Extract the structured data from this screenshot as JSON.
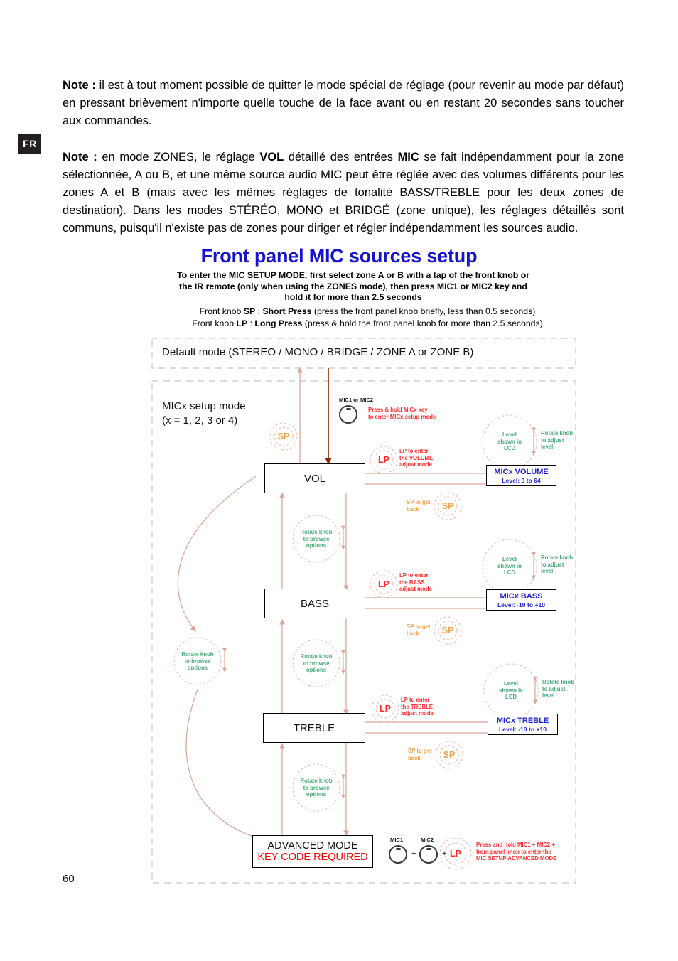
{
  "lang_tag": "FR",
  "page_number": "60",
  "notes": [
    "Note : il est à tout moment possible de quitter le mode spécial de réglage (pour revenir au mode par défaut) en pressant brièvement n'importe quelle touche de la face avant ou en restant 20 secondes sans toucher aux commandes.",
    "Note : en mode ZONES, le réglage VOL détaillé des entrées MIC se fait indépendamment pour la zone sélectionnée, A ou B, et une même source audio MIC peut être réglée avec des volumes différents pour les zones A et B (mais avec les mêmes réglages de tonalité BASS/TREBLE pour les deux zones de destination). Dans les modes STÉRÉO, MONO et BRIDGÉ (zone unique), les réglages détaillés sont communs, puisqu'il n'existe pas de zones pour diriger et régler indépendamment les sources audio."
  ],
  "heading": {
    "title": "Front panel MIC sources setup",
    "title_color": "#1414cf",
    "subtitle_lines": [
      "To enter the MIC SETUP MODE, first select zone A or B with a tap of the front knob or",
      "the IR remote (only when using the  ZONES mode), then press MIC1 or MIC2 key and",
      "hold it for more than 2.5 seconds"
    ]
  },
  "legend": {
    "sp": {
      "prefix": "Front knob  ",
      "code": "SP",
      "sep": " : ",
      "name": "Short Press",
      "desc": "  (press the front panel knob briefly, less than 0.5 seconds)"
    },
    "lp": {
      "prefix": "Front knob  ",
      "code": "LP",
      "sep": " : ",
      "name": "Long Press",
      "desc": "  (press & hold the front panel knob for more than 2.5 seconds)"
    }
  },
  "diagram": {
    "outer_frame_label": "Default mode (STEREO / MONO / BRIDGE / ZONE A or ZONE B)",
    "inner_frame_label": "MICx setup mode\n(x = 1, 2, 3 or 4)",
    "mic_entry": {
      "knob_label": "MIC1 or MIC2",
      "note": "Press & hold MICx key\nto enter MICx setup mode",
      "note_color": "#ff2b2b"
    },
    "top_token": {
      "label": "SP"
    },
    "steps": [
      {
        "name": "VOL",
        "lp_token": "LP",
        "lp_note": "LP to enter\nthe VOLUME\nadjust mode",
        "sp_token": "SP",
        "sp_note": "SP to get\nback",
        "lcd_title": "MICx VOLUME",
        "lcd_sub": "Level: 0 to 64",
        "level_circle": "Level\nshown in\nLCD",
        "rotate_note": "Rotate knob\nto adjust\nlevel"
      },
      {
        "name": "BASS",
        "lp_token": "LP",
        "lp_note": "LP to enter\nthe BASS\nadjust mode",
        "sp_token": "SP",
        "sp_note": "SP to get\nback",
        "lcd_title": "MICx BASS",
        "lcd_sub": "Level: -10 to +10",
        "level_circle": "Level\nshown in\nLCD",
        "rotate_note": "Rotate knob\nto adjust\nlevel"
      },
      {
        "name": "TREBLE",
        "lp_token": "LP",
        "lp_note": "LP to enter\nthe TREBLE\nadjust mode",
        "sp_token": "SP",
        "sp_note": "SP to get\nback",
        "lcd_title": "MICx TREBLE",
        "lcd_sub": "Level: -10 to +10",
        "level_circle": "Level\nshown in\nLCD",
        "rotate_note": "Rotate knob\nto adjust\nlevel"
      }
    ],
    "browse_notes": [
      "Rotate knob\nto browse\noptions",
      "Rotate knob\nto browse\noptions",
      "Rotate knob\nto browse\noptions",
      "Rotate knob\nto browse\noptions"
    ],
    "advanced": {
      "line1": "ADVANCED MODE",
      "line2": "KEY CODE REQUIRED",
      "line2_color": "#ff0000",
      "mic1_label": "MIC1",
      "mic2_label": "MIC2",
      "plus1": "+",
      "plus2": "+",
      "lp_token": "LP",
      "note": "Press and hold MIC1 + MIC2 +\nfront panel knob to enter the\nMIC SETUP ADVANCED MODE"
    }
  },
  "colors": {
    "flow_line": "#d9a79a",
    "mic_line": "#8b2500",
    "green": "#4aab7a",
    "red": "#ff2b2b",
    "orange": "#f5a04a",
    "blue": "#2222d8",
    "frame_dash": "#c8c8c8"
  }
}
